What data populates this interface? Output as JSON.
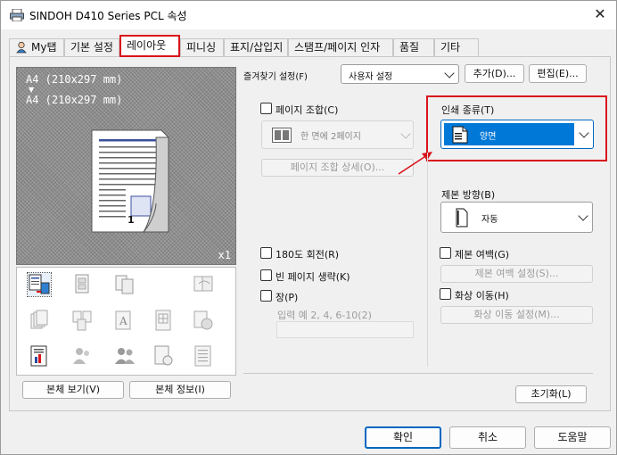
{
  "window": {
    "title": "SINDOH D410 Series PCL 속성",
    "close_glyph": "✕"
  },
  "tabs": [
    {
      "label": "My탭"
    },
    {
      "label": "기본 설정"
    },
    {
      "label": "레이아웃",
      "active": true
    },
    {
      "label": "피니싱"
    },
    {
      "label": "표지/삽입지"
    },
    {
      "label": "스탬프/페이지 인자"
    },
    {
      "label": "품질"
    },
    {
      "label": "기타"
    }
  ],
  "preview": {
    "paper_from": "A4 (210x297 mm)",
    "paper_to": "A4 (210x297 mm)",
    "page_number": "1",
    "copies": "x1"
  },
  "preview_buttons": {
    "view": "본체 보기(V)",
    "info": "본체 정보(I)"
  },
  "favorites": {
    "label": "즐겨찾기 설정(F)",
    "value": "사용자 설정",
    "add_label": "추가(D)...",
    "edit_label": "편집(E)..."
  },
  "combine": {
    "checkbox_label": "페이지 조합(C)",
    "value": "한 면에 2페이지",
    "detail_label": "페이지 조합 상세(O)..."
  },
  "print_type": {
    "label": "인쇄 종류(T)",
    "value": "양면"
  },
  "binding": {
    "label": "제본 방향(B)",
    "value": "자동"
  },
  "rotate180": {
    "label": "180도 회전(R)"
  },
  "skip_blank": {
    "label": "빈 페이지 생략(K)"
  },
  "chapter": {
    "label": "장(P)",
    "example": "입력 예 2, 4, 6-10(2)"
  },
  "binding_margin": {
    "label": "제본 여백(G)",
    "settings_label": "제본 여백 설정(S)..."
  },
  "image_shift": {
    "label": "화상 이동(H)",
    "settings_label": "화상 이동 설정(M)..."
  },
  "reset_label": "초기화(L)",
  "footer": {
    "ok": "확인",
    "cancel": "취소",
    "help": "도움말"
  },
  "colors": {
    "accent": "#0067c0",
    "highlight": "#d9141c",
    "selection": "#0078d7"
  }
}
